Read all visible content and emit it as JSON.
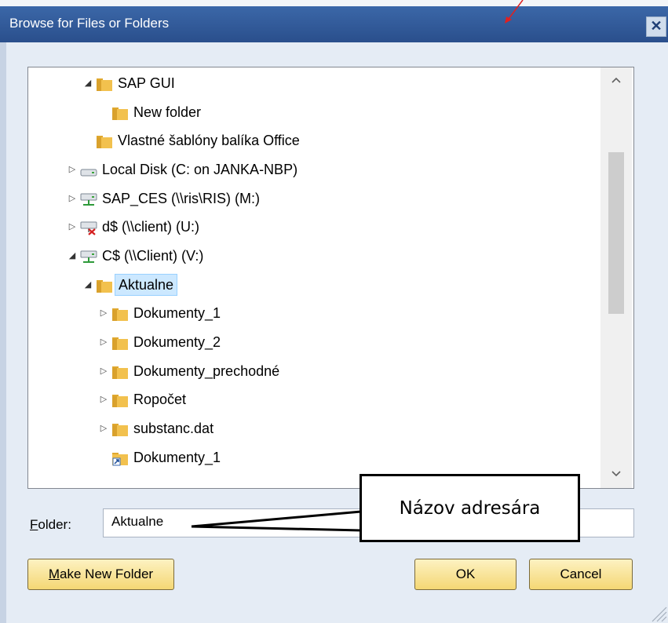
{
  "window": {
    "title": "Browse for Files or Folders",
    "close_glyph": "✕"
  },
  "tree": {
    "items": [
      {
        "label": "SAP GUI",
        "icon": "folder-icon",
        "expander": "open"
      },
      {
        "label": "New folder",
        "icon": "folder-icon",
        "expander": "none"
      },
      {
        "label": "Vlastné šablóny balíka Office",
        "icon": "folder-icon",
        "expander": "none"
      },
      {
        "label": "Local Disk (C: on JANKA-NBP)",
        "icon": "local-disk-icon",
        "expander": "closed"
      },
      {
        "label": "SAP_CES (\\\\ris\\RIS) (M:)",
        "icon": "network-drive-icon",
        "expander": "closed"
      },
      {
        "label": "d$ (\\\\client) (U:)",
        "icon": "disconnected-network-drive-icon",
        "expander": "closed"
      },
      {
        "label": "C$ (\\\\Client) (V:)",
        "icon": "network-drive-icon",
        "expander": "open"
      },
      {
        "label": "Aktualne",
        "icon": "folder-icon",
        "expander": "open",
        "selected": true
      },
      {
        "label": "Dokumenty_1",
        "icon": "folder-icon",
        "expander": "closed"
      },
      {
        "label": "Dokumenty_2",
        "icon": "folder-icon",
        "expander": "closed"
      },
      {
        "label": "Dokumenty_prechodné",
        "icon": "folder-icon",
        "expander": "closed"
      },
      {
        "label": "Ropočet",
        "icon": "folder-icon",
        "expander": "closed"
      },
      {
        "label": "substanc.dat",
        "icon": "folder-icon",
        "expander": "closed"
      },
      {
        "label": "Dokumenty_1",
        "icon": "shortcut-icon",
        "expander": "none"
      }
    ]
  },
  "folder_field": {
    "label_accel": "F",
    "label_rest": "older:",
    "value": "Aktualne"
  },
  "callout": {
    "text": "Názov adresára"
  },
  "buttons": {
    "make_new_folder_accel": "M",
    "make_new_folder_rest": "ake New Folder",
    "ok": "OK",
    "cancel": "Cancel"
  },
  "colors": {
    "title_bar": "#2f5a98",
    "selection": "#cce8ff",
    "button_gold": "#f4d774",
    "folder_yellow": "#f2c14e"
  }
}
